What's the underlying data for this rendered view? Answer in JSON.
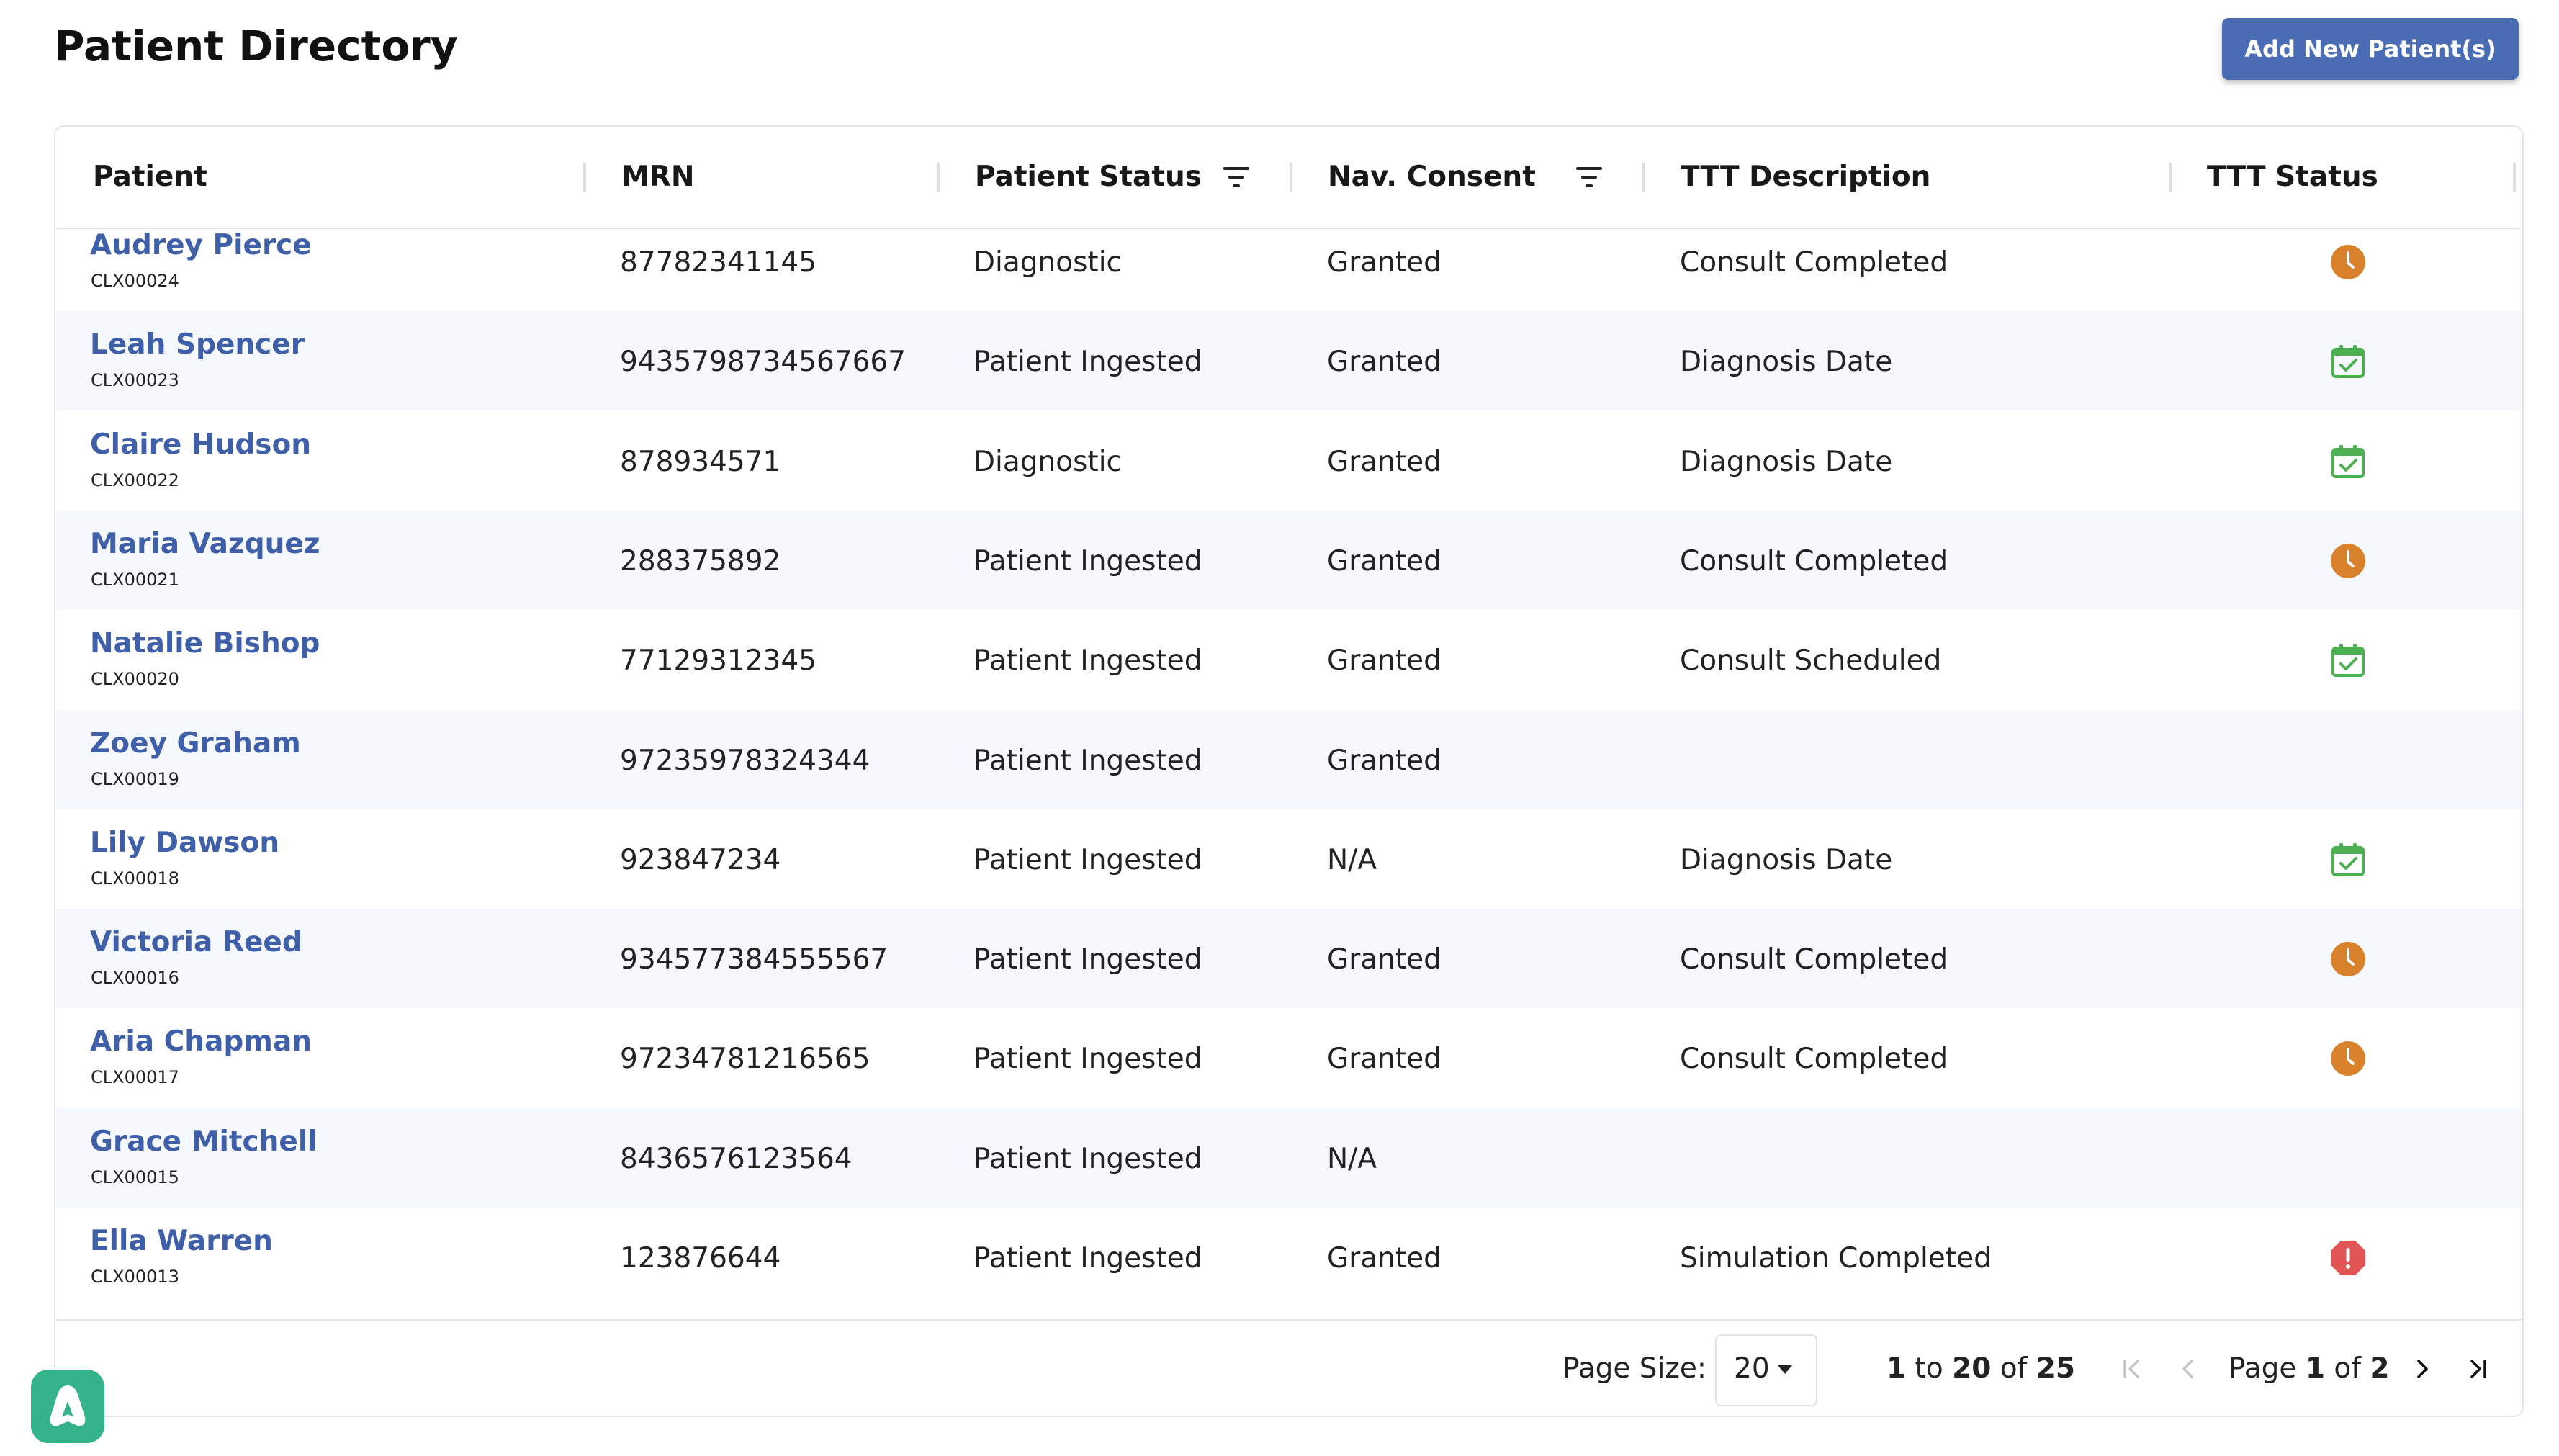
{
  "page": {
    "title": "Patient Directory"
  },
  "actions": {
    "add_button": "Add New Patient(s)"
  },
  "table": {
    "columns": [
      "Patient",
      "MRN",
      "Patient Status",
      "Nav. Consent",
      "TTT Description",
      "TTT Status"
    ],
    "rows": [
      {
        "name": "Audrey Pierce",
        "id": "CLX00024",
        "mrn": "87782341145",
        "status": "Diagnostic",
        "consent": "Granted",
        "ttt_desc": "Consult Completed",
        "ttt_status": "clock-icon"
      },
      {
        "name": "Leah Spencer",
        "id": "CLX00023",
        "mrn": "9435798734567667",
        "status": "Patient Ingested",
        "consent": "Granted",
        "ttt_desc": "Diagnosis Date",
        "ttt_status": "calendar-check-icon"
      },
      {
        "name": "Claire Hudson",
        "id": "CLX00022",
        "mrn": "878934571",
        "status": "Diagnostic",
        "consent": "Granted",
        "ttt_desc": "Diagnosis Date",
        "ttt_status": "calendar-check-icon"
      },
      {
        "name": "Maria Vazquez",
        "id": "CLX00021",
        "mrn": "288375892",
        "status": "Patient Ingested",
        "consent": "Granted",
        "ttt_desc": "Consult Completed",
        "ttt_status": "clock-icon"
      },
      {
        "name": "Natalie Bishop",
        "id": "CLX00020",
        "mrn": "77129312345",
        "status": "Patient Ingested",
        "consent": "Granted",
        "ttt_desc": "Consult Scheduled",
        "ttt_status": "calendar-check-icon"
      },
      {
        "name": "Zoey Graham",
        "id": "CLX00019",
        "mrn": "97235978324344",
        "status": "Patient Ingested",
        "consent": "Granted",
        "ttt_desc": "",
        "ttt_status": ""
      },
      {
        "name": "Lily Dawson",
        "id": "CLX00018",
        "mrn": "923847234",
        "status": "Patient Ingested",
        "consent": "N/A",
        "ttt_desc": "Diagnosis Date",
        "ttt_status": "calendar-check-icon"
      },
      {
        "name": "Victoria Reed",
        "id": "CLX00016",
        "mrn": "934577384555567",
        "status": "Patient Ingested",
        "consent": "Granted",
        "ttt_desc": "Consult Completed",
        "ttt_status": "clock-icon"
      },
      {
        "name": "Aria Chapman",
        "id": "CLX00017",
        "mrn": "97234781216565",
        "status": "Patient Ingested",
        "consent": "Granted",
        "ttt_desc": "Consult Completed",
        "ttt_status": "clock-icon"
      },
      {
        "name": "Grace Mitchell",
        "id": "CLX00015",
        "mrn": "8436576123564",
        "status": "Patient Ingested",
        "consent": "N/A",
        "ttt_desc": "",
        "ttt_status": ""
      },
      {
        "name": "Ella Warren",
        "id": "CLX00013",
        "mrn": "123876644",
        "status": "Patient Ingested",
        "consent": "Granted",
        "ttt_desc": "Simulation Completed",
        "ttt_status": "alert-octagon-icon"
      }
    ]
  },
  "pagination": {
    "page_size_label": "Page Size:",
    "page_size_value": "20",
    "range_from": "1",
    "range_to_word": "to",
    "range_to": "20",
    "range_of_word": "of",
    "range_total": "25",
    "page_word": "Page",
    "page_current": "1",
    "page_of_word": "of",
    "page_total": "2"
  },
  "colors": {
    "accent": "#4a6cb5",
    "link": "#3f5fa8",
    "clock": "#d9822b",
    "calendar": "#4caf50",
    "alert": "#e25555",
    "logo": "#35b38a"
  }
}
